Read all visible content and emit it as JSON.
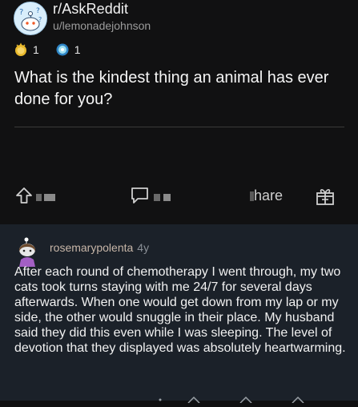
{
  "post": {
    "subreddit": "r/AskReddit",
    "author": "u/lemonadejohnson",
    "awards": [
      {
        "icon": "gold-award-icon",
        "count": "1"
      },
      {
        "icon": "helpful-award-icon",
        "count": "1"
      }
    ],
    "title": "What is the kindest thing an animal has ever done for you?",
    "actions": {
      "upvote_icon": "upvote-arrow-icon",
      "comment_icon": "comment-bubble-icon",
      "share_label": "hare",
      "gift_icon": "gift-icon"
    }
  },
  "comment": {
    "author": "rosemarypolenta",
    "age": "4y",
    "body": "After each round of chemotherapy I went through, my two cats took turns staying with me 24/7 for several days afterwards. When one would get down from my lap or my side, the other would snuggle in their place. My husband said they did this even while I was sleeping. The level of devotion that they displayed was absolutely heartwarming."
  },
  "colors": {
    "post_bg": "#111112",
    "comment_bg": "#1b2129",
    "author_color": "#c7b6a8"
  }
}
